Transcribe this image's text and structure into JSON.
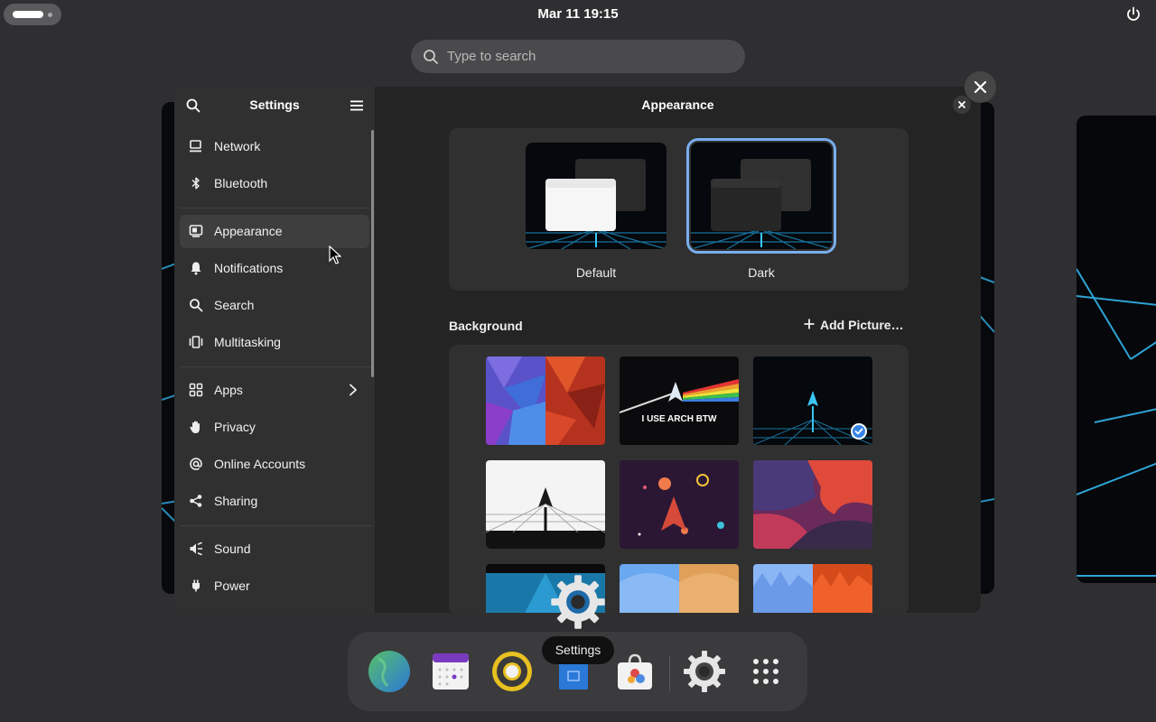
{
  "topbar": {
    "clock": "Mar 11  19:15",
    "icons": [
      "activities-indicator",
      "power-icon"
    ]
  },
  "search": {
    "placeholder": "Type to search",
    "icon": "search-icon"
  },
  "settings": {
    "sidebar_title": "Settings",
    "content_title": "Appearance",
    "nav": [
      {
        "label": "Network",
        "icon": "network-icon"
      },
      {
        "label": "Bluetooth",
        "icon": "bluetooth-icon"
      },
      {
        "label": "Appearance",
        "icon": "appearance-icon",
        "active": true
      },
      {
        "label": "Notifications",
        "icon": "bell-icon"
      },
      {
        "label": "Search",
        "icon": "search-icon"
      },
      {
        "label": "Multitasking",
        "icon": "multitasking-icon"
      },
      {
        "label": "Apps",
        "icon": "apps-grid-icon",
        "chevron": true
      },
      {
        "label": "Privacy",
        "icon": "hand-icon"
      },
      {
        "label": "Online Accounts",
        "icon": "at-icon"
      },
      {
        "label": "Sharing",
        "icon": "share-icon"
      },
      {
        "label": "Sound",
        "icon": "speaker-icon"
      },
      {
        "label": "Power",
        "icon": "power-plug-icon"
      }
    ],
    "styles": [
      {
        "label": "Default",
        "selected": false
      },
      {
        "label": "Dark",
        "selected": true
      }
    ],
    "background_label": "Background",
    "add_picture_label": "Add Picture…",
    "wallpaper_selected_index": 2,
    "wallpaper_text": "I USE ARCH BTW"
  },
  "drag": {
    "tooltip": "Settings"
  },
  "dock": {
    "items": [
      "web-browser-icon",
      "calendar-icon",
      "rhythmbox-icon",
      "files-icon",
      "software-icon",
      "settings-icon",
      "app-grid-icon"
    ]
  },
  "colors": {
    "accent": "#78aeed",
    "selected_check": "#3584e4",
    "window_bg": "#242424",
    "sidebar_bg": "#303030"
  }
}
